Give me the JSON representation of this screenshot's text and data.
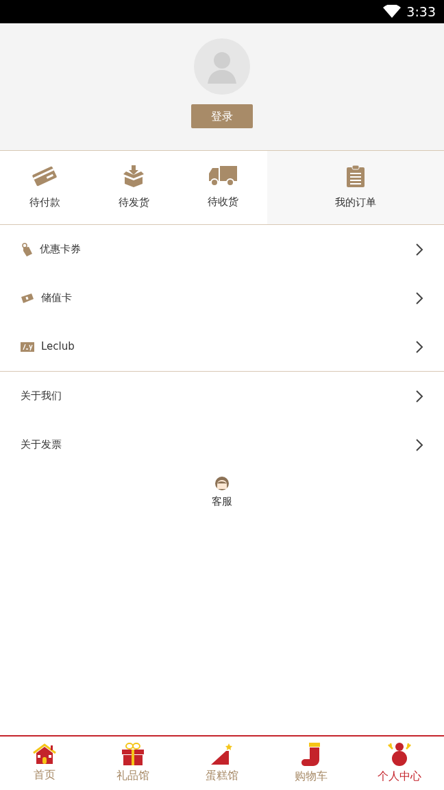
{
  "status_bar": {
    "time": "3:33"
  },
  "profile": {
    "login_button": "登录"
  },
  "orders": [
    {
      "kind": "card",
      "label": "待付款"
    },
    {
      "kind": "box",
      "label": "待发货"
    },
    {
      "kind": "truck",
      "label": "待收货"
    },
    {
      "kind": "clipboard",
      "label": "我的订单"
    }
  ],
  "menu_groups": [
    [
      {
        "kind": "tag",
        "label": "优惠卡券"
      },
      {
        "kind": "ticket",
        "label": "储值卡"
      },
      {
        "kind": "leclub",
        "label": "Leclub"
      }
    ],
    [
      {
        "kind": "none",
        "label": "关于我们"
      },
      {
        "kind": "none",
        "label": "关于发票"
      }
    ]
  ],
  "service": {
    "label": "客服"
  },
  "tab_bar": [
    {
      "kind": "house",
      "label": "首页",
      "selected": false
    },
    {
      "kind": "gift",
      "label": "礼品馆",
      "selected": false
    },
    {
      "kind": "cake",
      "label": "蛋糕馆",
      "selected": false
    },
    {
      "kind": "sock",
      "label": "购物车",
      "selected": false
    },
    {
      "kind": "snowman",
      "label": "个人中心",
      "selected": true
    }
  ]
}
